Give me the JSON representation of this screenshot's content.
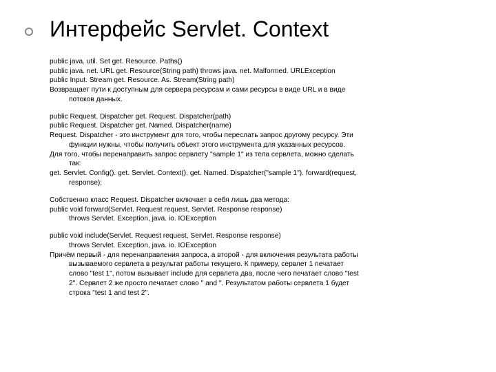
{
  "title": "Интерфейс Servlet. Context",
  "p1": {
    "l1": "public java. util. Set get. Resource. Paths()",
    "l2": "public java. net. URL get. Resource(String path) throws java. net. Malformed. URLException",
    "l3": "public Input. Stream get. Resource. As. Stream(String path)",
    "l4": "Возвращает пути к доступным для сервера ресурсам и сами ресурсы в виде URL и в виде",
    "l5": "потоков данных."
  },
  "p2": {
    "l1": "public Request. Dispatcher get. Request. Dispatcher(path)",
    "l2": "public Request. Dispatcher get. Named. Dispatcher(name)",
    "l3": "Request. Dispatcher - это инструмент для того, чтобы переслать запрос другому ресурсу. Эти",
    "l4": "функции нужны, чтобы получить объект этого инструмента для указанных ресурсов.",
    "l5": "Для того, чтобы перенаправить запрос сервлету \"sample 1\" из тела сервлета, можно сделать",
    "l6": "так:",
    "l7": "get. Servlet. Config(). get. Servlet. Context(). get. Named. Dispatcher(\"sample 1\"). forward(request,",
    "l8": "response);"
  },
  "p3": {
    "l1": "Собственно класс Request. Dispatcher включает в себя лишь два метода:",
    "l2": "public void forward(Servlet. Request request, Servlet. Response response)",
    "l3": "throws Servlet. Exception, java. io. IOException"
  },
  "p4": {
    "l1": "public void include(Servlet. Request request, Servlet. Response response)",
    "l2": "throws Servlet. Exception, java. io. IOException",
    "l3": "Причём первый - для перенаправления запроса, а второй - для включения результата работы",
    "l4": "вызываемого сервлета в результат работы текущего. К примеру, сервлет 1 печатает",
    "l5": "слово \"test 1\", потом вызывает include для сервлета два, после чего печатает слово \"test",
    "l6": "2\". Сервлет 2 же просто печатает слово \" and \". Результатом работы сервлета 1 будет",
    "l7": "строка \"test 1 and test 2\"."
  }
}
